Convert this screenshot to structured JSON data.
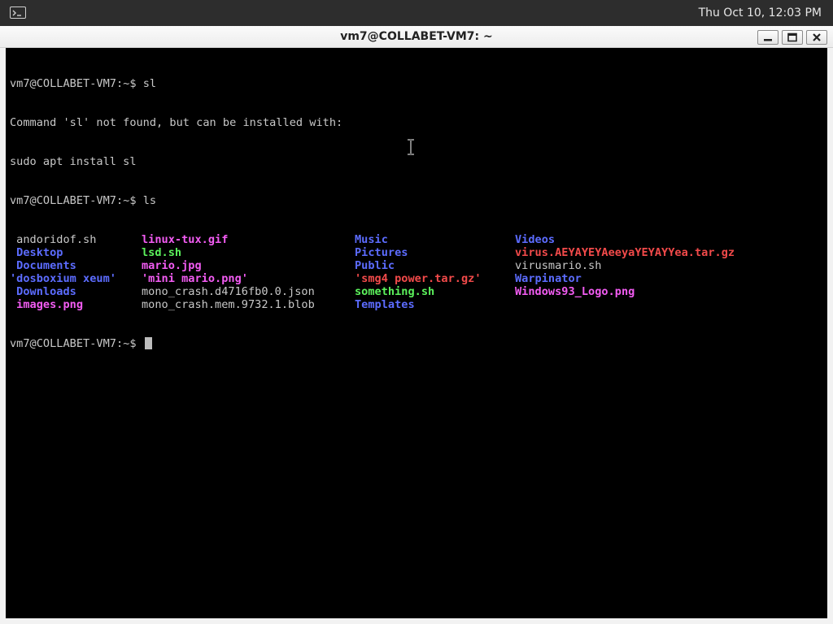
{
  "topbar": {
    "clock": "Thu Oct 10, 12:03 PM",
    "icon": "terminal-icon"
  },
  "window": {
    "title": "vm7@COLLABET-VM7: ~",
    "buttons": [
      "minimize-icon",
      "maximize-icon",
      "close-icon"
    ]
  },
  "colors": {
    "background": "#000000",
    "default_text": "#c8c8c8",
    "directory": "#5c6cff",
    "executable": "#5cf25c",
    "image": "#f35cf3",
    "archive": "#f24a4a"
  },
  "terminal": {
    "lines": [
      {
        "prompt": "vm7@COLLABET-VM7:~$ ",
        "command": "sl"
      },
      {
        "text": "Command 'sl' not found, but can be installed with:"
      },
      {
        "text": "sudo apt install sl"
      },
      {
        "prompt": "vm7@COLLABET-VM7:~$ ",
        "command": "ls"
      }
    ],
    "listing": [
      [
        {
          "name": " andoridof.sh",
          "type": "plain"
        },
        {
          "name": "linux-tux.gif",
          "type": "image"
        },
        {
          "name": "Music",
          "type": "directory"
        },
        {
          "name": "Videos",
          "type": "directory"
        }
      ],
      [
        {
          "name": " Desktop",
          "type": "directory"
        },
        {
          "name": "lsd.sh",
          "type": "executable"
        },
        {
          "name": "Pictures",
          "type": "directory"
        },
        {
          "name": "virus.AEYAYEYAeeyaYEYAYYea.tar.gz",
          "type": "archive"
        }
      ],
      [
        {
          "name": " Documents",
          "type": "directory"
        },
        {
          "name": "mario.jpg",
          "type": "image"
        },
        {
          "name": "Public",
          "type": "directory"
        },
        {
          "name": "virusmario.sh",
          "type": "plain"
        }
      ],
      [
        {
          "name": "'dosboxium xeum'",
          "type": "directory"
        },
        {
          "name": "'mini mario.png'",
          "type": "image"
        },
        {
          "name": "'smg4 power.tar.gz'",
          "type": "archive"
        },
        {
          "name": "Warpinator",
          "type": "directory"
        }
      ],
      [
        {
          "name": " Downloads",
          "type": "directory"
        },
        {
          "name": "mono_crash.d4716fb0.0.json",
          "type": "plain"
        },
        {
          "name": "something.sh",
          "type": "executable"
        },
        {
          "name": "Windows93_Logo.png",
          "type": "image"
        }
      ],
      [
        {
          "name": " images.png",
          "type": "image"
        },
        {
          "name": "mono_crash.mem.9732.1.blob",
          "type": "plain"
        },
        {
          "name": "Templates",
          "type": "directory"
        },
        {
          "name": "",
          "type": "plain"
        }
      ]
    ],
    "final_prompt": "vm7@COLLABET-VM7:~$ "
  }
}
